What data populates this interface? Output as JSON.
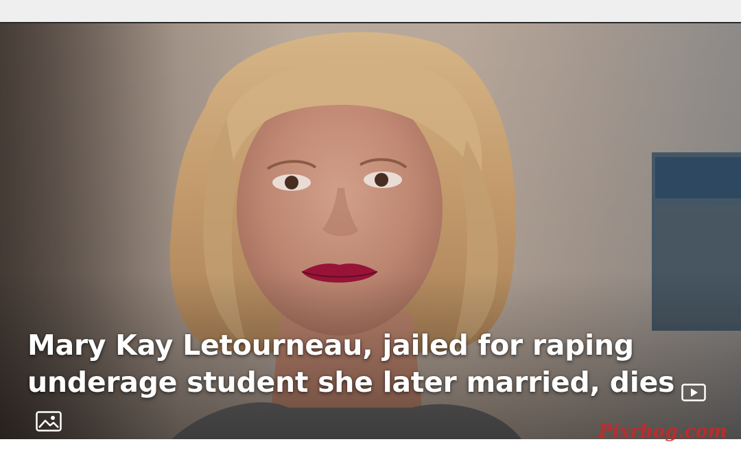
{
  "article": {
    "headline": "Mary Kay Letourneau, jailed for raping underage student she later married, dies"
  },
  "icons": {
    "video": "video-play-icon",
    "image": "image-gallery-icon"
  },
  "watermark": "Pixrbog.com",
  "colors": {
    "headline_text": "#ffffff",
    "watermark": "#cc2727",
    "topbar": "#efefef"
  }
}
